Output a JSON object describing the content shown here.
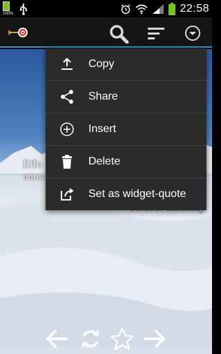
{
  "status_bar": {
    "battery_percent_label": "100%",
    "time": "22:58"
  },
  "menu": {
    "items": [
      {
        "label": "Copy",
        "icon": "upload-icon"
      },
      {
        "label": "Share",
        "icon": "share-icon"
      },
      {
        "label": "Insert",
        "icon": "add-circle-icon"
      },
      {
        "label": "Delete",
        "icon": "trash-icon"
      },
      {
        "label": "Set as widget-quote",
        "icon": "widget-export-icon"
      }
    ]
  },
  "quote": {
    "text_line1": "Effo",
    "text_line2": "enou",
    "author": "John F. Kennedy"
  },
  "colors": {
    "accent": "#2f9bd1",
    "menu_bg": "#2b2b2b",
    "battery_green": "#79c21e"
  }
}
